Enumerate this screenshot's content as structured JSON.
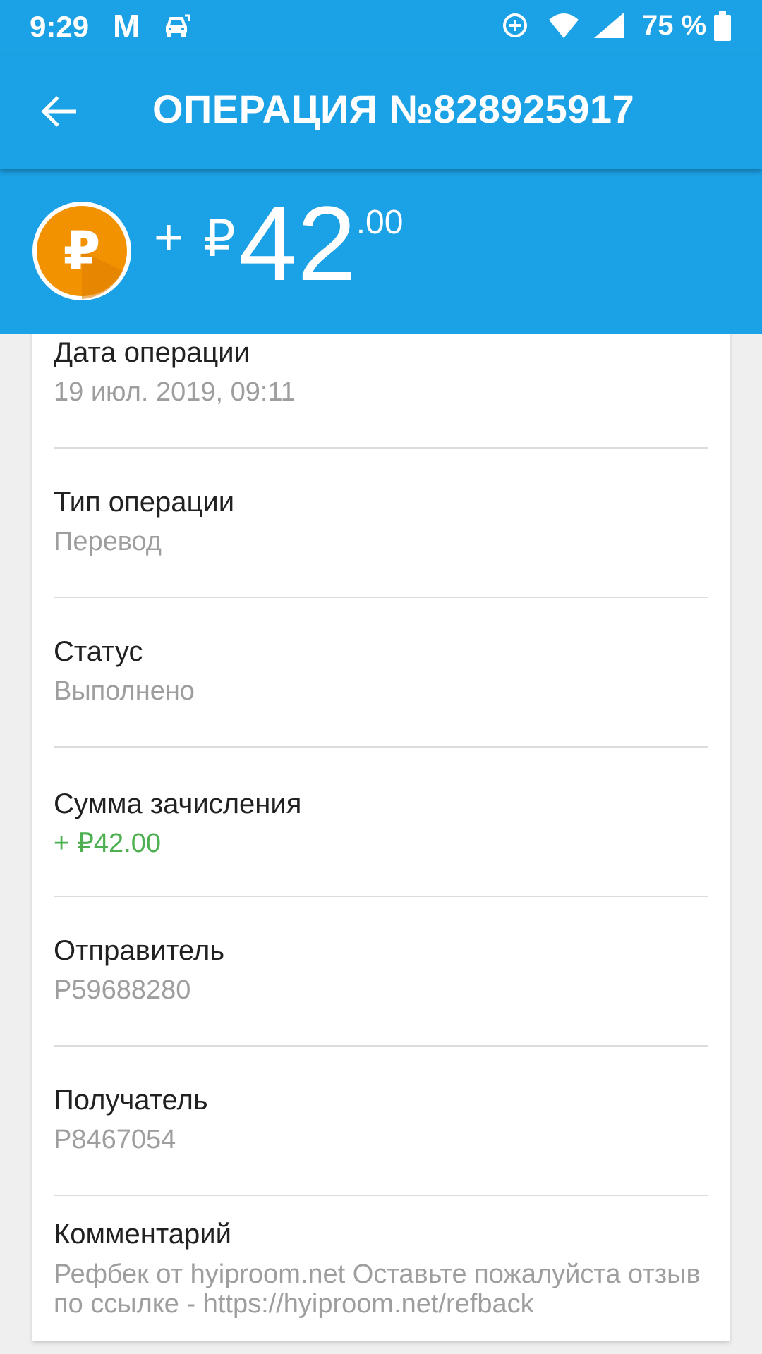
{
  "status_bar": {
    "time": "9:29",
    "notification_letter": "M",
    "battery_percent": "75 %",
    "icons": [
      "gmail-icon",
      "car-icon",
      "data-saver-icon",
      "wifi-icon",
      "signal-icon",
      "battery-icon"
    ]
  },
  "app_bar": {
    "title": "ОПЕРАЦИЯ №828925917",
    "back_icon": "arrow-left-icon"
  },
  "hero": {
    "sign": "+",
    "currency": "₽",
    "amount_major": "42",
    "amount_minor": ".00",
    "coin_symbol": "₽",
    "coin_color": "#f39200"
  },
  "details": {
    "date_label": "Дата операции",
    "date_value": "19 июл. 2019, 09:11",
    "type_label": "Тип операции",
    "type_value": "Перевод",
    "status_label": "Статус",
    "status_value": "Выполнено",
    "credit_label": "Сумма зачисления",
    "credit_value": "+ ₽42.00",
    "sender_label": "Отправитель",
    "sender_value": "P59688280",
    "recipient_label": "Получатель",
    "recipient_value": "P8467054",
    "comment_label": "Комментарий",
    "comment_value": "Рефбек от hyiproom.net  Оставьте пожалуйста отзыв по ссылке - https://hyiproom.net/refback"
  },
  "colors": {
    "primary": "#1ba1e5",
    "positive": "#4caf50",
    "secondary_text": "#9e9e9e"
  }
}
